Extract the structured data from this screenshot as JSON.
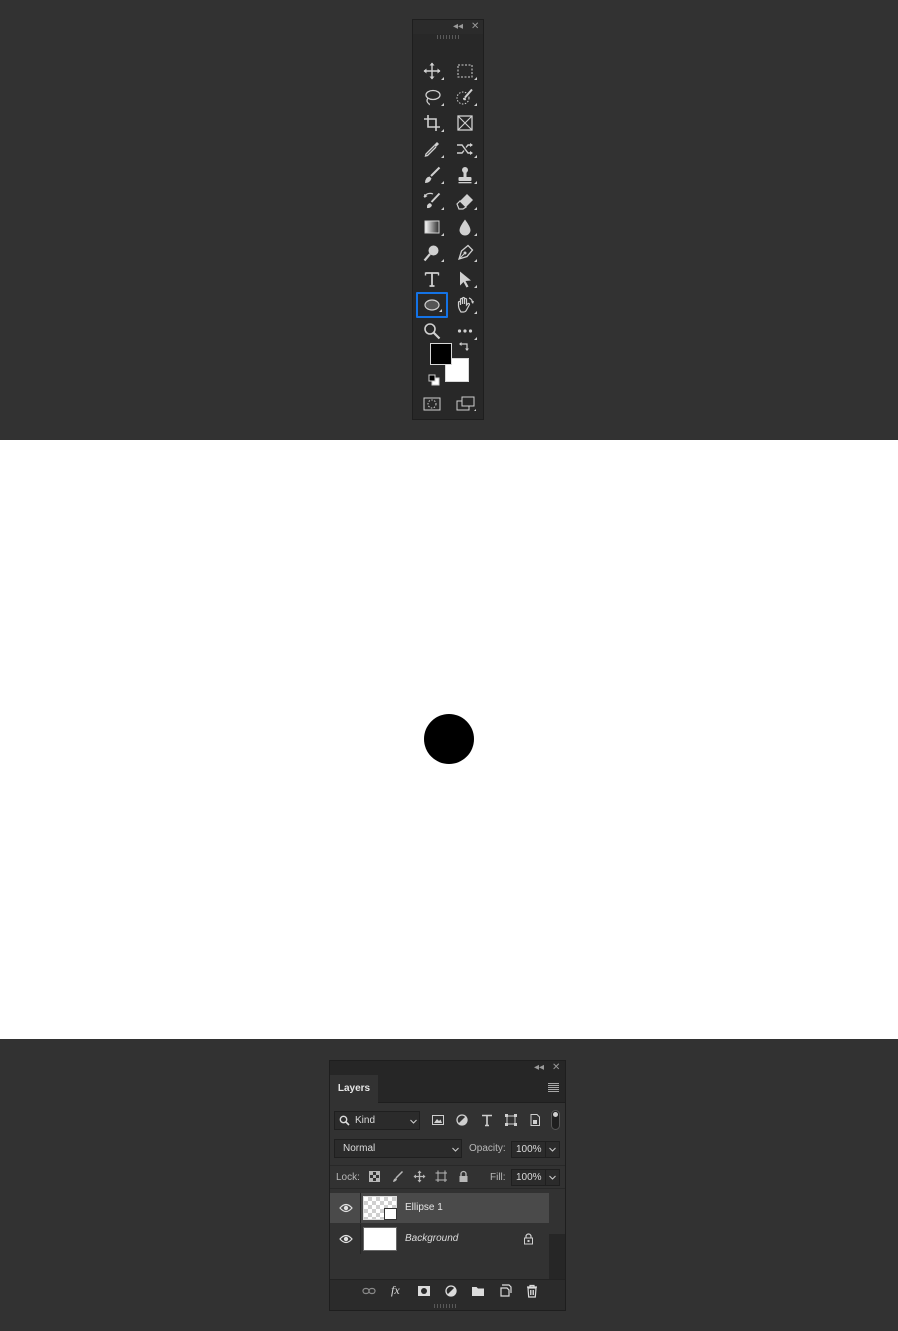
{
  "toolbar": {
    "collapse_glyph": "◂◂",
    "close_glyph": "✕",
    "tools": [
      {
        "name": "move-tool",
        "icon": "move-icon"
      },
      {
        "name": "rectangular-marquee-tool",
        "icon": "marquee-icon"
      },
      {
        "name": "lasso-tool",
        "icon": "lasso-icon"
      },
      {
        "name": "quick-selection-tool",
        "icon": "quick-selection-icon"
      },
      {
        "name": "crop-tool",
        "icon": "crop-icon"
      },
      {
        "name": "frame-tool",
        "icon": "frame-icon"
      },
      {
        "name": "eyedropper-tool",
        "icon": "eyedropper-icon"
      },
      {
        "name": "content-aware-move-tool",
        "icon": "content-aware-move-icon"
      },
      {
        "name": "brush-tool",
        "icon": "brush-icon"
      },
      {
        "name": "clone-stamp-tool",
        "icon": "stamp-icon"
      },
      {
        "name": "history-brush-tool",
        "icon": "history-brush-icon"
      },
      {
        "name": "eraser-tool",
        "icon": "eraser-icon"
      },
      {
        "name": "gradient-tool",
        "icon": "gradient-icon"
      },
      {
        "name": "blur-tool",
        "icon": "blur-drop-icon"
      },
      {
        "name": "dodge-tool",
        "icon": "dodge-icon"
      },
      {
        "name": "pen-tool",
        "icon": "pen-icon"
      },
      {
        "name": "type-tool",
        "icon": "type-icon"
      },
      {
        "name": "path-selection-tool",
        "icon": "arrow-icon"
      },
      {
        "name": "ellipse-tool",
        "icon": "ellipse-icon",
        "active": true
      },
      {
        "name": "hand-tool",
        "icon": "hand-icon"
      },
      {
        "name": "zoom-tool",
        "icon": "zoom-icon"
      },
      {
        "name": "edit-toolbar",
        "icon": "more-icon"
      }
    ],
    "foreground_color": "#000000",
    "background_color": "#ffffff",
    "active_outline_color": "#1473e6"
  },
  "canvas": {
    "background": "#ffffff",
    "ellipse_fill": "#000000"
  },
  "layers_panel": {
    "collapse_glyph": "◂◂",
    "close_glyph": "✕",
    "tab_label": "Layers",
    "filter_kind": "Kind",
    "blend_mode": "Normal",
    "opacity_label": "Opacity:",
    "opacity_value": "100%",
    "lock_label": "Lock:",
    "fill_label": "Fill:",
    "fill_value": "100%",
    "layers": [
      {
        "name": "Ellipse 1",
        "selected": true,
        "visible": true
      },
      {
        "name": "Background",
        "selected": false,
        "visible": true,
        "locked": true
      }
    ],
    "footer_fx": "fx"
  }
}
